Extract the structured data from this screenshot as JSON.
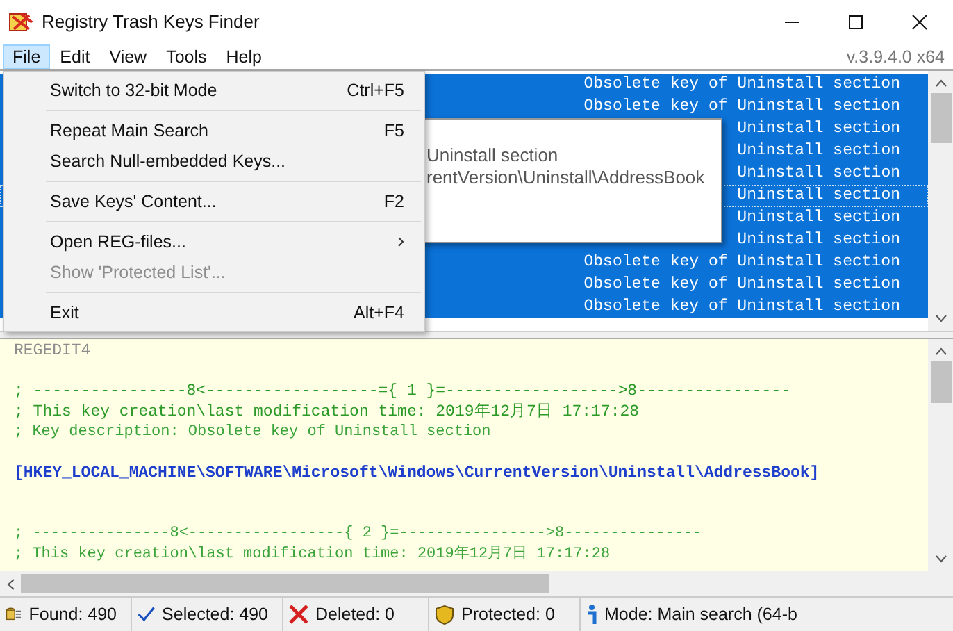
{
  "window": {
    "title": "Registry Trash Keys Finder"
  },
  "menu_bar": {
    "items": [
      {
        "label": "File",
        "selected": true
      },
      {
        "label": "Edit",
        "selected": false
      },
      {
        "label": "View",
        "selected": false
      },
      {
        "label": "Tools",
        "selected": false
      },
      {
        "label": "Help",
        "selected": false
      }
    ],
    "version": "v.3.9.4.0 x64"
  },
  "file_menu": [
    {
      "kind": "item",
      "label": "Switch to 32-bit Mode",
      "shortcut": "Ctrl+F5",
      "disabled": false
    },
    {
      "kind": "separator"
    },
    {
      "kind": "item",
      "label": "Repeat Main Search",
      "shortcut": "F5",
      "disabled": false
    },
    {
      "kind": "item",
      "label": "Search Null-embedded Keys...",
      "disabled": false
    },
    {
      "kind": "separator"
    },
    {
      "kind": "item",
      "label": "Save Keys' Content...",
      "shortcut": "F2",
      "disabled": false
    },
    {
      "kind": "separator"
    },
    {
      "kind": "submenu",
      "label": "Open REG-files...",
      "disabled": false
    },
    {
      "kind": "item",
      "label": "Show 'Protected List'...",
      "disabled": true
    },
    {
      "kind": "separator"
    },
    {
      "kind": "item",
      "label": "Exit",
      "shortcut": "Alt+F4",
      "disabled": false
    }
  ],
  "key_list": {
    "rows": [
      {
        "description": "Obsolete key of Uninstall section",
        "selected": true,
        "focused": false
      },
      {
        "description": "Obsolete key of Uninstall section",
        "selected": true,
        "focused": false
      },
      {
        "description": "Uninstall section",
        "selected": true,
        "focused": false
      },
      {
        "description": "Uninstall section",
        "selected": true,
        "focused": false
      },
      {
        "description": "Uninstall section",
        "selected": true,
        "focused": false
      },
      {
        "description": "Uninstall section",
        "selected": true,
        "focused": true
      },
      {
        "description": "Uninstall section",
        "selected": true,
        "focused": false
      },
      {
        "description": "Uninstall section",
        "selected": true,
        "focused": false
      },
      {
        "description": "Obsolete key of Uninstall section",
        "selected": true,
        "focused": false
      },
      {
        "description": "Obsolete key of Uninstall section",
        "selected": true,
        "focused": false
      },
      {
        "description": "Obsolete key of Uninstall section",
        "selected": true,
        "focused": false
      }
    ],
    "tooltip": [
      "Uninstall section",
      "rentVersion\\Uninstall\\AddressBook"
    ]
  },
  "reg_view": {
    "lines": [
      {
        "kind": "header",
        "text": "REGEDIT4"
      },
      {
        "kind": "blank"
      },
      {
        "kind": "comment",
        "text": "; ----------------8<------------------={ 1 }=------------------>8----------------"
      },
      {
        "kind": "comment",
        "text": "; This key creation\\last modification time: 2019年12月7日 17:17:28"
      },
      {
        "kind": "note",
        "text": "; Key description: Obsolete key of Uninstall section"
      },
      {
        "kind": "blank"
      },
      {
        "kind": "key",
        "text": "[HKEY_LOCAL_MACHINE\\SOFTWARE\\Microsoft\\Windows\\CurrentVersion\\Uninstall\\AddressBook]"
      },
      {
        "kind": "blank"
      },
      {
        "kind": "blank"
      },
      {
        "kind": "note",
        "text": "; ---------------8<-----------------{ 2 }=---------------->8---------------"
      },
      {
        "kind": "note",
        "text": "; This key creation\\last modification time: 2019年12月7日 17:17:28"
      }
    ]
  },
  "status_bar": [
    {
      "kind": "found",
      "text": "Found: 490"
    },
    {
      "kind": "selected",
      "text": "Selected: 490"
    },
    {
      "kind": "deleted",
      "text": "Deleted: 0"
    },
    {
      "kind": "protected",
      "text": "Protected: 0"
    },
    {
      "kind": "info",
      "text": "Mode: Main search (64-b"
    }
  ]
}
